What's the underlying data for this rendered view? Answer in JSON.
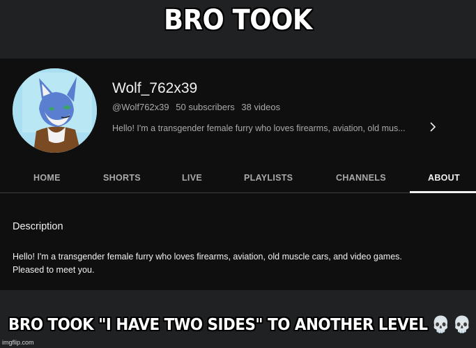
{
  "meme": {
    "top_caption": "BRO TOOK",
    "bottom_caption": "BRO TOOK \"I HAVE TWO SIDES\" TO ANOTHER LEVEL",
    "bottom_emoji": "💀💀💀",
    "watermark": "imgflip.com"
  },
  "channel": {
    "name": "Wolf_762x39",
    "handle": "@Wolf762x39",
    "subscribers": "50 subscribers",
    "videos": "38 videos",
    "description_preview": "Hello! I'm a transgender female furry who loves firearms, aviation, old mus...",
    "avatar_icon": "wolf-avatar-icon"
  },
  "tabs": [
    {
      "label": "HOME"
    },
    {
      "label": "SHORTS"
    },
    {
      "label": "LIVE"
    },
    {
      "label": "PLAYLISTS"
    },
    {
      "label": "CHANNELS"
    },
    {
      "label": "ABOUT",
      "active": true
    }
  ],
  "about": {
    "heading": "Description",
    "text": "Hello! I'm a transgender female furry who loves firearms, aviation, old muscle cars, and video games. Pleased to meet you."
  },
  "colors": {
    "page_bg": "#0f0f0f",
    "meme_bg": "#1f2123",
    "text_primary": "#f1f1f1",
    "text_secondary": "#aaaaaa"
  }
}
